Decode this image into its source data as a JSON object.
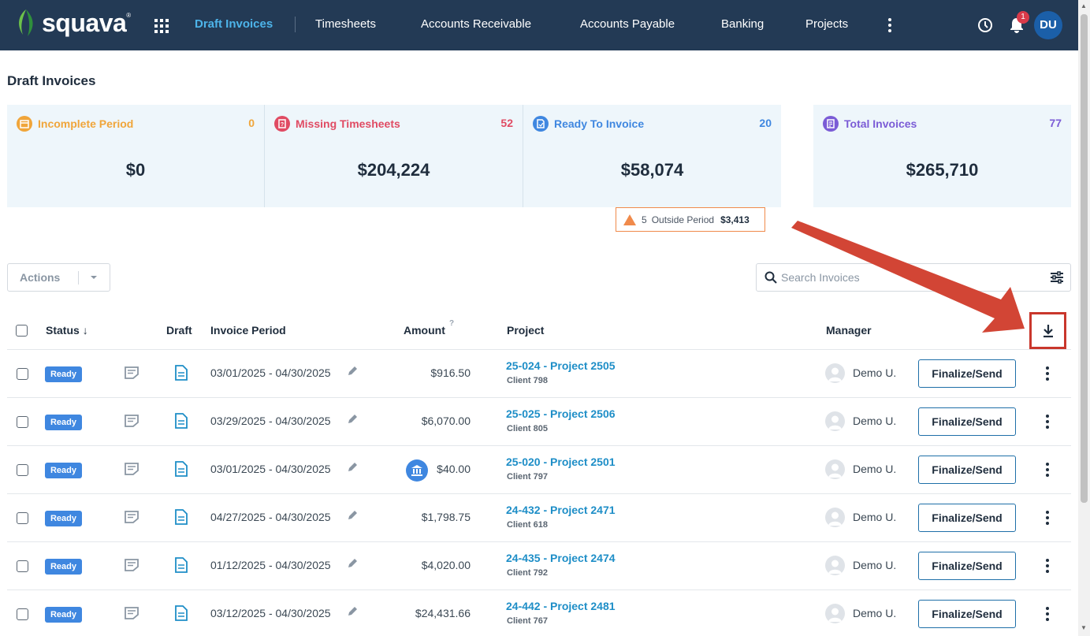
{
  "app": {
    "brand": "squava",
    "reg_mark": "®"
  },
  "nav": {
    "items": [
      {
        "label": "Draft Invoices",
        "active": true
      },
      {
        "label": "Timesheets"
      },
      {
        "label": "Accounts Receivable"
      },
      {
        "label": "Accounts Payable"
      },
      {
        "label": "Banking"
      },
      {
        "label": "Projects"
      }
    ],
    "notification_count": "1",
    "user_initials": "DU"
  },
  "page": {
    "title": "Draft Invoices"
  },
  "cards": [
    {
      "label": "Incomplete Period",
      "count": "0",
      "amount": "$0",
      "color": "#f0a53a"
    },
    {
      "label": "Missing Timesheets",
      "count": "52",
      "amount": "$204,224",
      "color": "#e04b63"
    },
    {
      "label": "Ready To Invoice",
      "count": "20",
      "amount": "$58,074",
      "color": "#3f87e0"
    },
    {
      "label": "Total Invoices",
      "count": "77",
      "amount": "$265,710",
      "color": "#7b5cd6"
    }
  ],
  "outside_period": {
    "count": "5",
    "label": "Outside Period",
    "amount": "$3,413"
  },
  "toolbar": {
    "actions_label": "Actions",
    "search_placeholder": "Search Invoices"
  },
  "table": {
    "headers": {
      "status": "Status",
      "draft": "Draft",
      "period": "Invoice Period",
      "amount": "Amount",
      "amount_help": "?",
      "project": "Project",
      "manager": "Manager"
    },
    "finalize_label": "Finalize/Send",
    "rows": [
      {
        "status": "Ready",
        "period": "03/01/2025 - 04/30/2025",
        "amount": "$916.50",
        "project": "25-024 - Project 2505",
        "client": "Client 798",
        "manager": "Demo U.",
        "bank": false
      },
      {
        "status": "Ready",
        "period": "03/29/2025 - 04/30/2025",
        "amount": "$6,070.00",
        "project": "25-025 - Project 2506",
        "client": "Client 805",
        "manager": "Demo U.",
        "bank": false
      },
      {
        "status": "Ready",
        "period": "03/01/2025 - 04/30/2025",
        "amount": "$40.00",
        "project": "25-020 - Project 2501",
        "client": "Client 797",
        "manager": "Demo U.",
        "bank": true
      },
      {
        "status": "Ready",
        "period": "04/27/2025 - 04/30/2025",
        "amount": "$1,798.75",
        "project": "24-432 - Project 2471",
        "client": "Client 618",
        "manager": "Demo U.",
        "bank": false
      },
      {
        "status": "Ready",
        "period": "01/12/2025 - 04/30/2025",
        "amount": "$4,020.00",
        "project": "24-435 - Project 2474",
        "client": "Client 792",
        "manager": "Demo U.",
        "bank": false
      },
      {
        "status": "Ready",
        "period": "03/12/2025 - 04/30/2025",
        "amount": "$24,431.66",
        "project": "24-442 - Project 2481",
        "client": "Client 767",
        "manager": "Demo U.",
        "bank": false
      }
    ]
  },
  "colors": {
    "nav_bg": "#233a55",
    "accent": "#4db4ea",
    "link": "#1e8ec7",
    "badge": "#3f87e0",
    "highlight": "#c9372c"
  }
}
